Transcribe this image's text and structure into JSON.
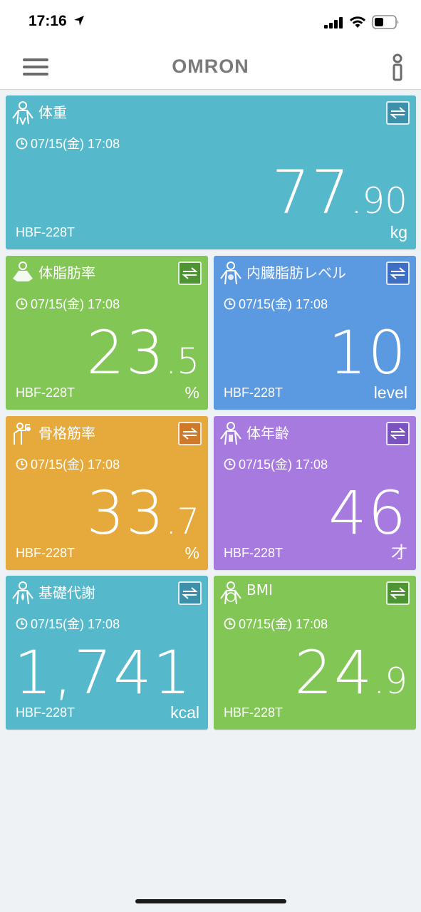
{
  "status_bar": {
    "time": "17:16"
  },
  "header": {
    "brand": "OMRON"
  },
  "cards": [
    {
      "title": "体重",
      "time": "07/15(金) 17:08",
      "value_int": "77",
      "value_dec": "90",
      "unit": "kg",
      "device": "HBF-228T",
      "color": "#56b9cb",
      "button_color": "#3e8faa"
    },
    {
      "title": "体脂肪率",
      "time": "07/15(金) 17:08",
      "value_int": "23",
      "value_dec": "5",
      "unit": "%",
      "device": "HBF-228T",
      "color": "#82c655",
      "button_color": "#4e9433"
    },
    {
      "title": "内臓脂肪レベル",
      "time": "07/15(金) 17:08",
      "value_int": "10",
      "value_dec": "",
      "unit": "level",
      "device": "HBF-228T",
      "color": "#5b99e0",
      "button_color": "#3e6fc4"
    },
    {
      "title": "骨格筋率",
      "time": "07/15(金) 17:08",
      "value_int": "33",
      "value_dec": "7",
      "unit": "%",
      "device": "HBF-228T",
      "color": "#e5a93c",
      "button_color": "#cf7a2b"
    },
    {
      "title": "体年齢",
      "time": "07/15(金) 17:08",
      "value_int": "46",
      "value_dec": "",
      "unit": "才",
      "device": "HBF-228T",
      "color": "#a77ae0",
      "button_color": "#7b53bf"
    },
    {
      "title": "基礎代謝",
      "time": "07/15(金) 17:08",
      "value_int": "1,741",
      "value_dec": "",
      "unit": "kcal",
      "device": "HBF-228T",
      "color": "#56b9cb",
      "button_color": "#3e8faa"
    },
    {
      "title": "BMI",
      "time": "07/15(金) 17:08",
      "value_int": "24",
      "value_dec": "9",
      "unit": "",
      "device": "HBF-228T",
      "color": "#82c655",
      "button_color": "#4e9433"
    }
  ]
}
